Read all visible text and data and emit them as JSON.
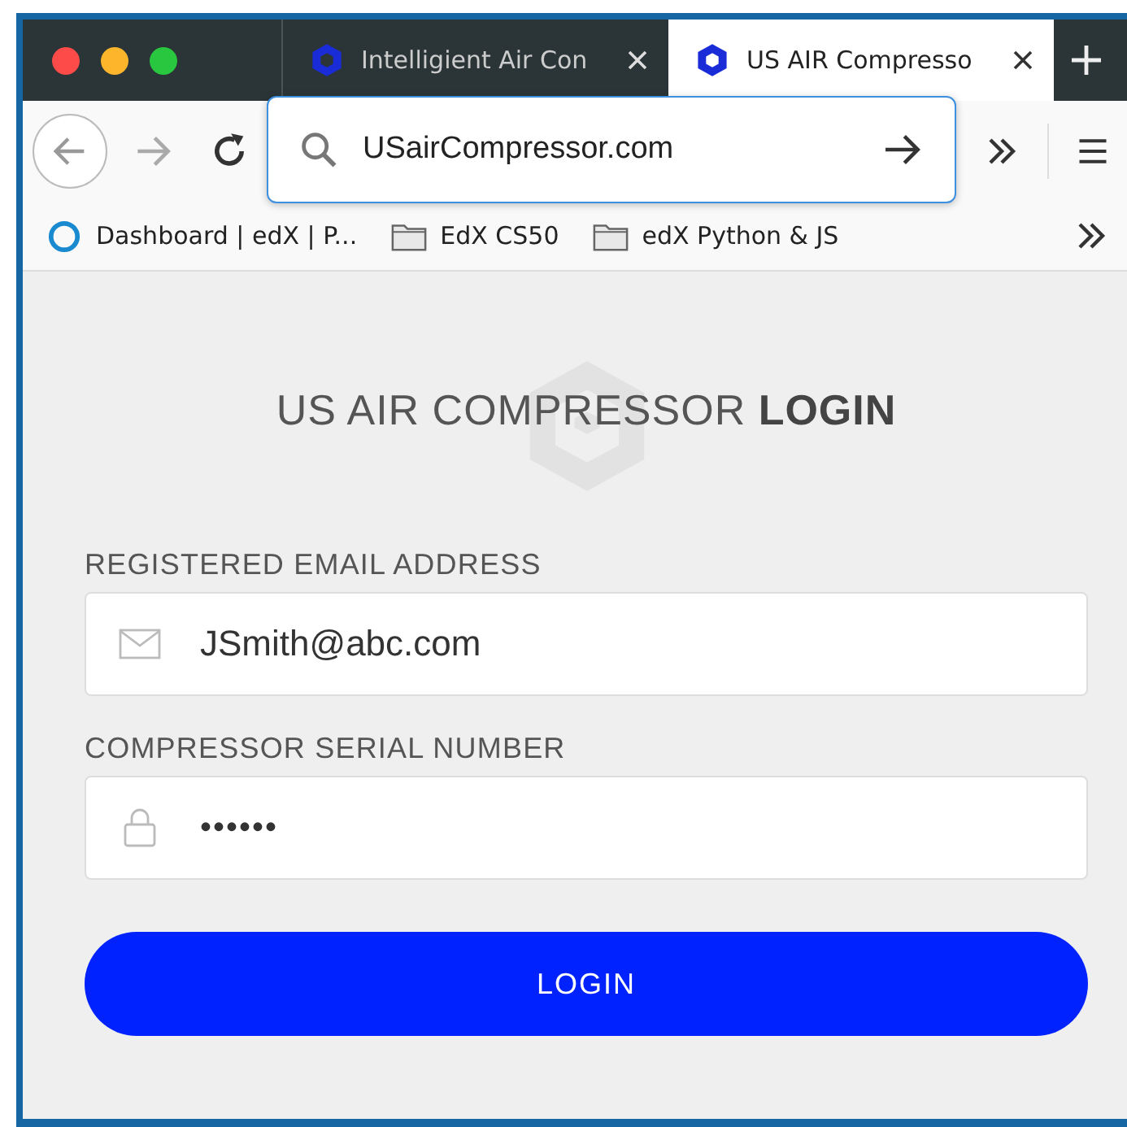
{
  "tabs": [
    {
      "title": "Intelligient Air Con",
      "selected": false
    },
    {
      "title": "US AIR Compresso",
      "selected": true
    }
  ],
  "address_bar": {
    "value": "USairCompressor.com"
  },
  "bookmarks": [
    {
      "kind": "site",
      "label": "Dashboard | edX | P..."
    },
    {
      "kind": "folder",
      "label": "EdX CS50"
    },
    {
      "kind": "folder",
      "label": "edX Python & JS"
    }
  ],
  "heading": "US AIR COMPRESSOR **LOGIN**",
  "fields": [
    {
      "kind": "email",
      "label": "REGISTERED EMAIL ADDRESS",
      "value": "JSmith@abc.com"
    },
    {
      "kind": "password",
      "label": "COMPRESSOR SERIAL NUMBER",
      "value": "••••••"
    }
  ],
  "login_button": "LOGIN"
}
